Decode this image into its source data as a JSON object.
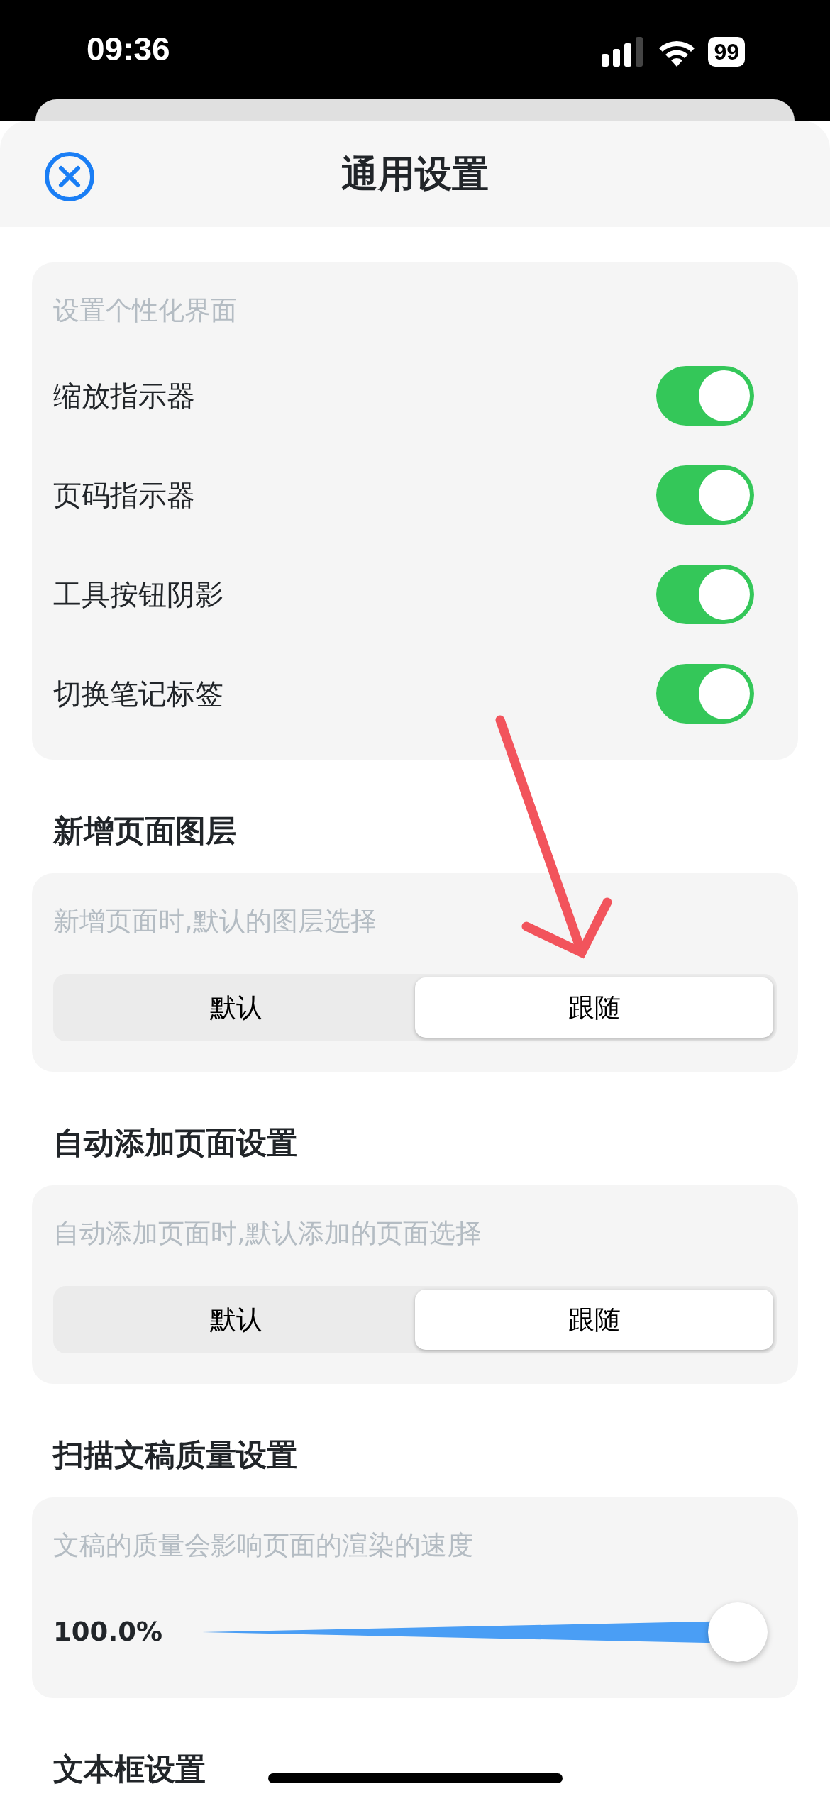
{
  "status_bar": {
    "time": "09:36",
    "battery": "99"
  },
  "header": {
    "title": "通用设置"
  },
  "sections": [
    {
      "kind": "toggles",
      "description": "设置个性化界面",
      "items": [
        {
          "label": "缩放指示器",
          "on": true
        },
        {
          "label": "页码指示器",
          "on": true
        },
        {
          "label": "工具按钮阴影",
          "on": true
        },
        {
          "label": "切换笔记标签",
          "on": true
        }
      ]
    },
    {
      "kind": "segmented",
      "title": "新增页面图层",
      "description": "新增页面时,默认的图层选择",
      "options": [
        {
          "label": "默认",
          "selected": false
        },
        {
          "label": "跟随",
          "selected": true
        }
      ]
    },
    {
      "kind": "segmented",
      "title": "自动添加页面设置",
      "description": "自动添加页面时,默认添加的页面选择",
      "options": [
        {
          "label": "默认",
          "selected": false
        },
        {
          "label": "跟随",
          "selected": true
        }
      ]
    },
    {
      "kind": "slider",
      "title": "扫描文稿质量设置",
      "description": "文稿的质量会影响页面的渲染的速度",
      "reading": "100.0%",
      "level": 1.0
    },
    {
      "kind": "heading",
      "title": "文本框设置"
    }
  ]
}
